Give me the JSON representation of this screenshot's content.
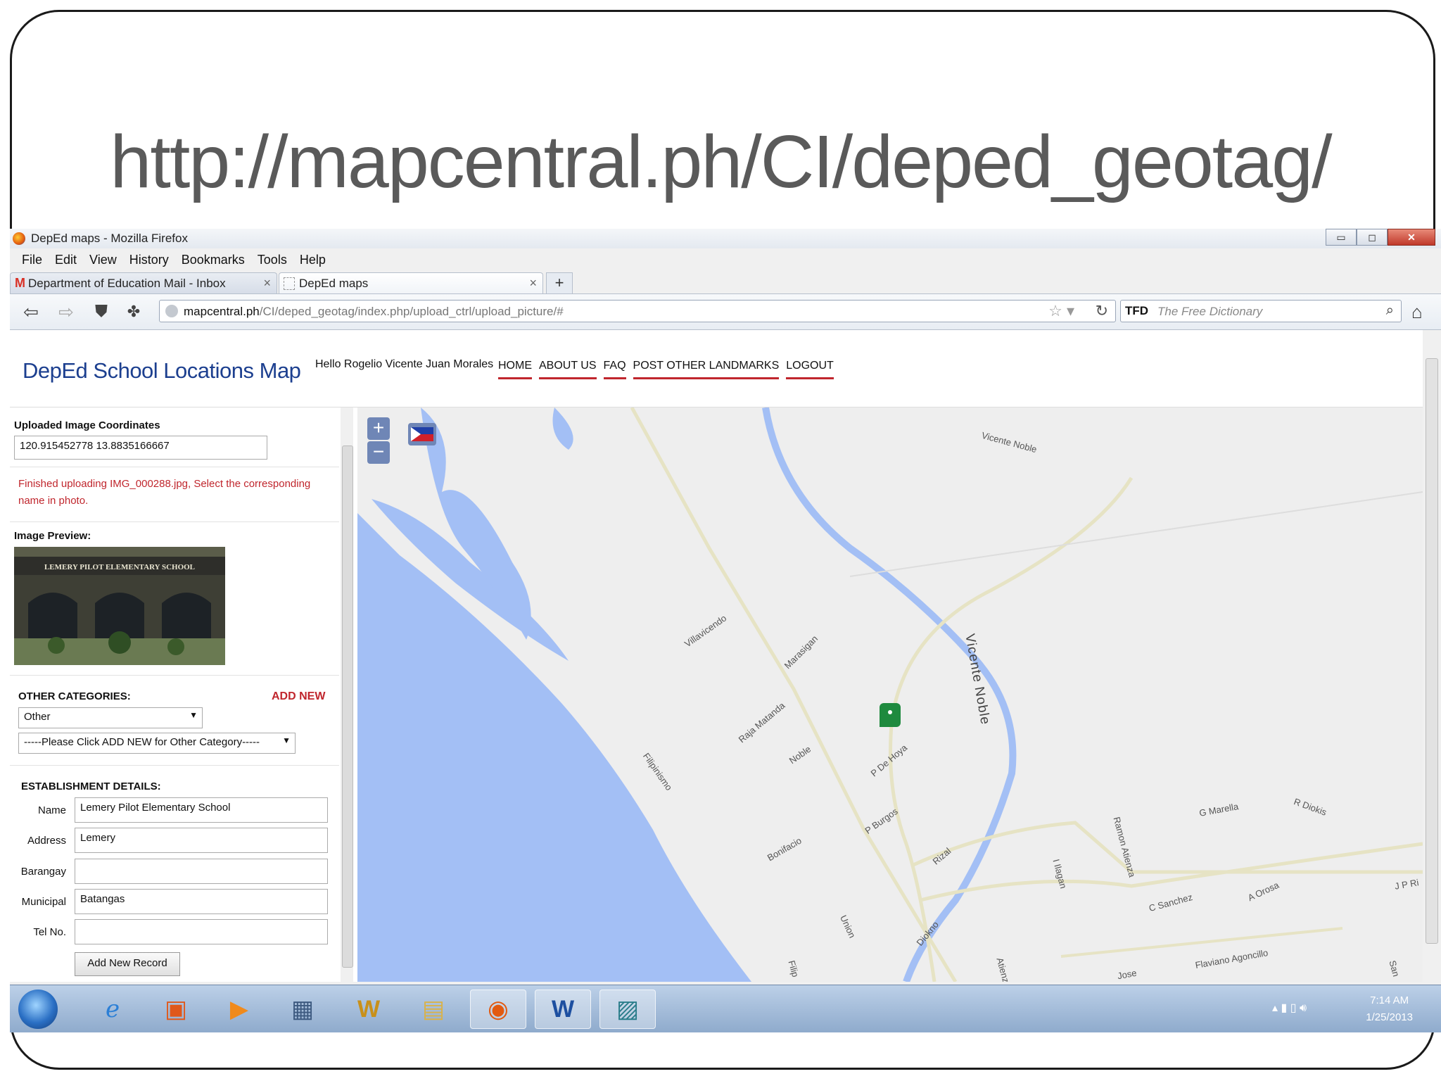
{
  "slide": {
    "title": "http://mapcentral.ph/CI/deped_geotag/"
  },
  "window": {
    "title": "DepEd maps - Mozilla Firefox"
  },
  "menu": [
    "File",
    "Edit",
    "View",
    "History",
    "Bookmarks",
    "Tools",
    "Help"
  ],
  "tabs": [
    {
      "label": "Department of Education Mail - Inbox"
    },
    {
      "label": "DepEd maps"
    }
  ],
  "url": {
    "host": "mapcentral.ph",
    "path": "/CI/deped_geotag/index.php/upload_ctrl/upload_picture/#"
  },
  "search": {
    "engine": "TFD",
    "placeholder": "The Free Dictionary"
  },
  "site": {
    "logo": "DepEd School Locations Map",
    "greeting": "Hello Rogelio Vicente Juan Morales",
    "nav": [
      "HOME",
      "ABOUT US",
      "FAQ",
      "POST OTHER LANDMARKS",
      "LOGOUT"
    ]
  },
  "panel": {
    "coords_label": "Uploaded Image Coordinates",
    "coords_value": "120.915452778 13.8835166667",
    "message": "Finished uploading IMG_000288.jpg, Select the corresponding name in photo.",
    "preview_label": "Image Preview:",
    "preview_sign": "LEMERY PILOT ELEMENTARY SCHOOL",
    "other_categories_label": "OTHER CATEGORIES:",
    "add_new": "ADD NEW",
    "category_select": "Other",
    "subcategory_select": "-----Please Click ADD NEW for Other Category-----",
    "establishment_label": "ESTABLISHMENT DETAILS:",
    "fields": [
      {
        "label": "Name",
        "value": "Lemery Pilot Elementary School"
      },
      {
        "label": "Address",
        "value": "Lemery"
      },
      {
        "label": "Barangay",
        "value": ""
      },
      {
        "label": "Municipal",
        "value": "Batangas"
      },
      {
        "label": "Tel No.",
        "value": ""
      }
    ],
    "submit": "Add New Record"
  },
  "map": {
    "zoom_in": "+",
    "zoom_out": "−",
    "streets": [
      "Vicente Noble",
      "Villavicendo",
      "Marasigan",
      "Raja Matanda",
      "Noble",
      "P De Hoya",
      "Filipinismo",
      "P Burgos",
      "Bonifacio",
      "Rizal",
      "Union",
      "Diokno",
      "Vicente Noble",
      "Ramon Atienza",
      "G Marella",
      "R Diokis",
      "I Ilagan",
      "C Sanchez",
      "A Orosa",
      "J P Ri",
      "Flaviano Agoncillo",
      "Jose",
      "Atienza",
      "Filip",
      "San"
    ],
    "colors": {
      "water": "#a3bff5",
      "land": "#eeeeee",
      "road": "#e6e3c4",
      "marker": "#1e8a3e"
    }
  },
  "taskbar": {
    "icons": [
      "ie-icon",
      "office-icon",
      "media-player-icon",
      "calculator-icon",
      "winrar-icon",
      "folder-icon",
      "firefox-icon",
      "word-icon",
      "photo-icon"
    ],
    "time": "7:14 AM",
    "date": "1/25/2013"
  }
}
